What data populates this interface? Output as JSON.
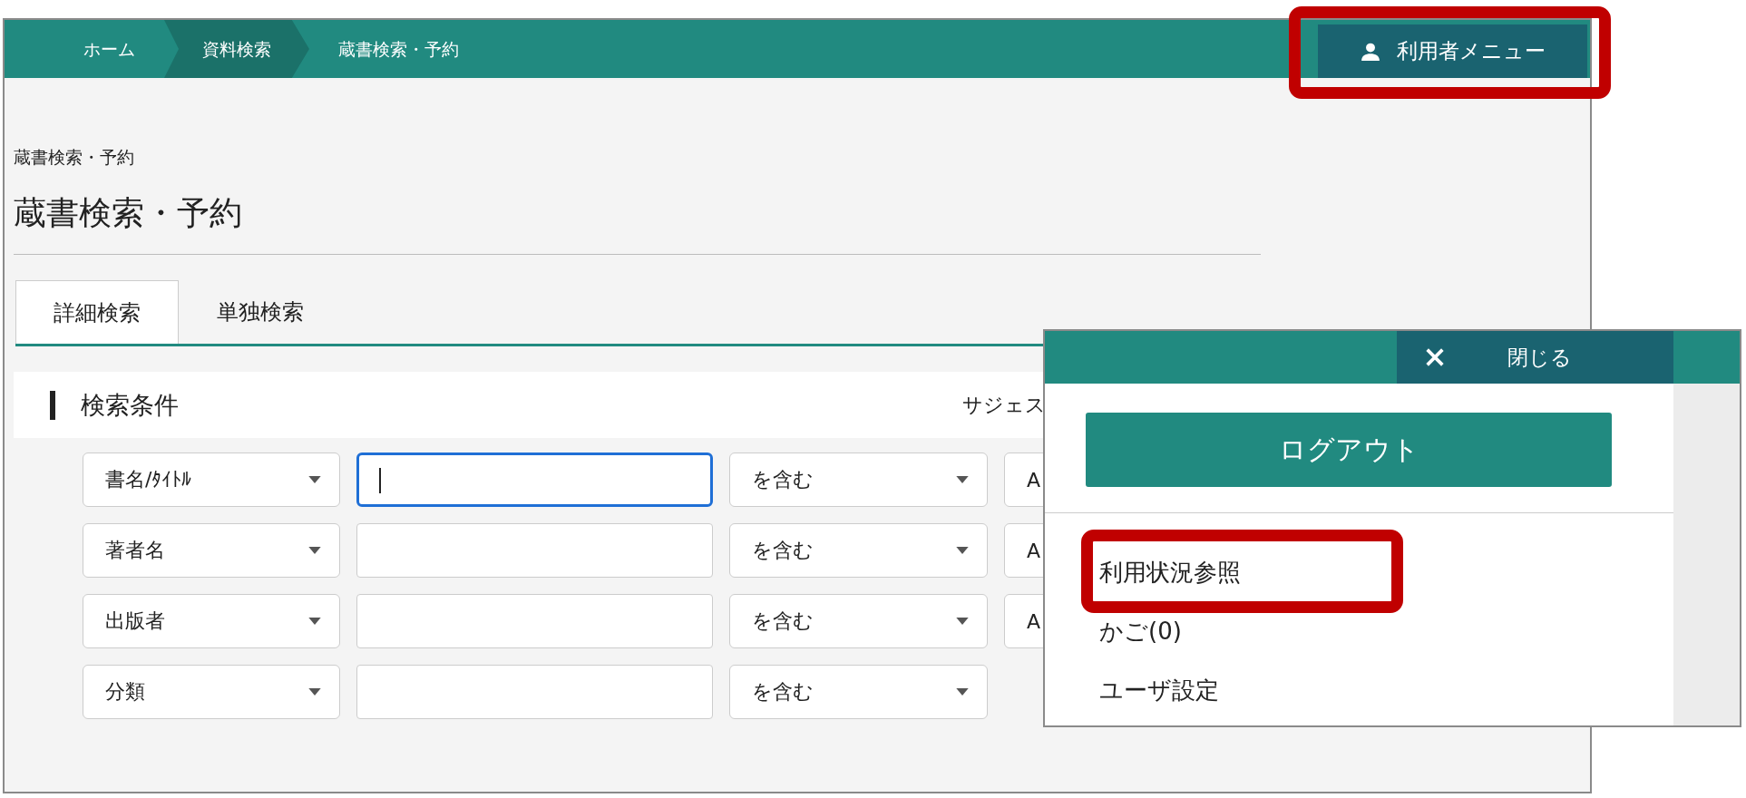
{
  "breadcrumbs": [
    {
      "label": "ホーム",
      "selected": false
    },
    {
      "label": "資料検索",
      "selected": true
    },
    {
      "label": "蔵書検索・予約",
      "selected": false
    }
  ],
  "user_menu_button": {
    "label": "利用者メニュー",
    "highlighted": true
  },
  "page": {
    "breadcrumb_heading": "蔵書検索・予約",
    "title": "蔵書検索・予約"
  },
  "tabs": [
    {
      "label": "詳細検索",
      "selected": true
    },
    {
      "label": "単独検索",
      "selected": false
    }
  ],
  "search_panel": {
    "heading": "検索条件",
    "suggest_label": "サジェス",
    "rows": [
      {
        "field": "書名/ﾀｲﾄﾙ",
        "focused": true,
        "operator": "を含む",
        "column_4": "A"
      },
      {
        "field": "著者名",
        "focused": false,
        "operator": "を含む",
        "column_4": "A"
      },
      {
        "field": "出版者",
        "focused": false,
        "operator": "を含む",
        "column_4": "A"
      },
      {
        "field": "分類",
        "focused": false,
        "operator": "を含む"
      }
    ]
  },
  "user_menu": {
    "close_label": "閉じる",
    "logout_label": "ログアウト",
    "items": [
      {
        "label": "利用状況参照",
        "highlighted": true
      },
      {
        "label": "かご(0)",
        "highlighted": false
      },
      {
        "label": "ユーザ設定",
        "highlighted": false
      }
    ]
  }
}
